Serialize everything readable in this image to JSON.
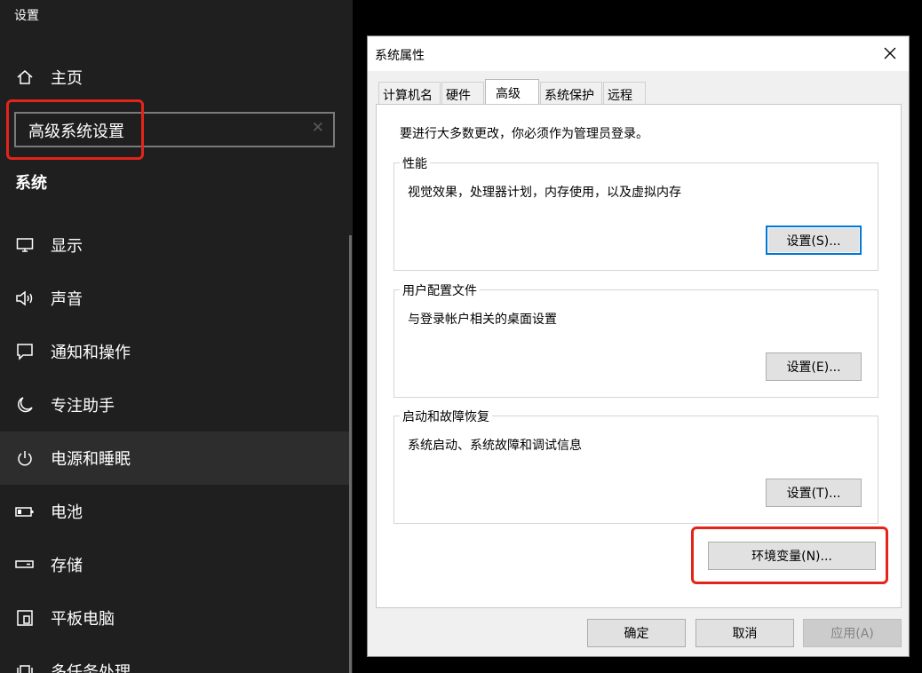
{
  "settings": {
    "window_title": "设置",
    "home_label": "主页",
    "search_value": "高级系统设置",
    "search_clear": "✕",
    "section": "系统",
    "items": [
      {
        "label": "显示",
        "icon": "display-icon"
      },
      {
        "label": "声音",
        "icon": "speaker-icon"
      },
      {
        "label": "通知和操作",
        "icon": "notification-icon"
      },
      {
        "label": "专注助手",
        "icon": "moon-icon"
      },
      {
        "label": "电源和睡眠",
        "icon": "power-icon",
        "active": true
      },
      {
        "label": "电池",
        "icon": "battery-icon"
      },
      {
        "label": "存储",
        "icon": "storage-icon"
      },
      {
        "label": "平板电脑",
        "icon": "tablet-icon"
      },
      {
        "label": "多任务处理",
        "icon": "multitask-icon"
      }
    ]
  },
  "dialog": {
    "title": "系统属性",
    "tabs": [
      "计算机名",
      "硬件",
      "高级",
      "系统保护",
      "远程"
    ],
    "active_tab": "高级",
    "admin_note": "要进行大多数更改，你必须作为管理员登录。",
    "groups": [
      {
        "legend": "性能",
        "desc": "视觉效果，处理器计划，内存使用，以及虚拟内存",
        "button": "设置(S)..."
      },
      {
        "legend": "用户配置文件",
        "desc": "与登录帐户相关的桌面设置",
        "button": "设置(E)..."
      },
      {
        "legend": "启动和故障恢复",
        "desc": "系统启动、系统故障和调试信息",
        "button": "设置(T)..."
      }
    ],
    "env_button": "环境变量(N)...",
    "ok": "确定",
    "cancel": "取消",
    "apply": "应用(A)"
  },
  "colors": {
    "highlight": "#e3241b",
    "accent": "#0078d7",
    "sidebar_bg": "#1f1f1f"
  }
}
